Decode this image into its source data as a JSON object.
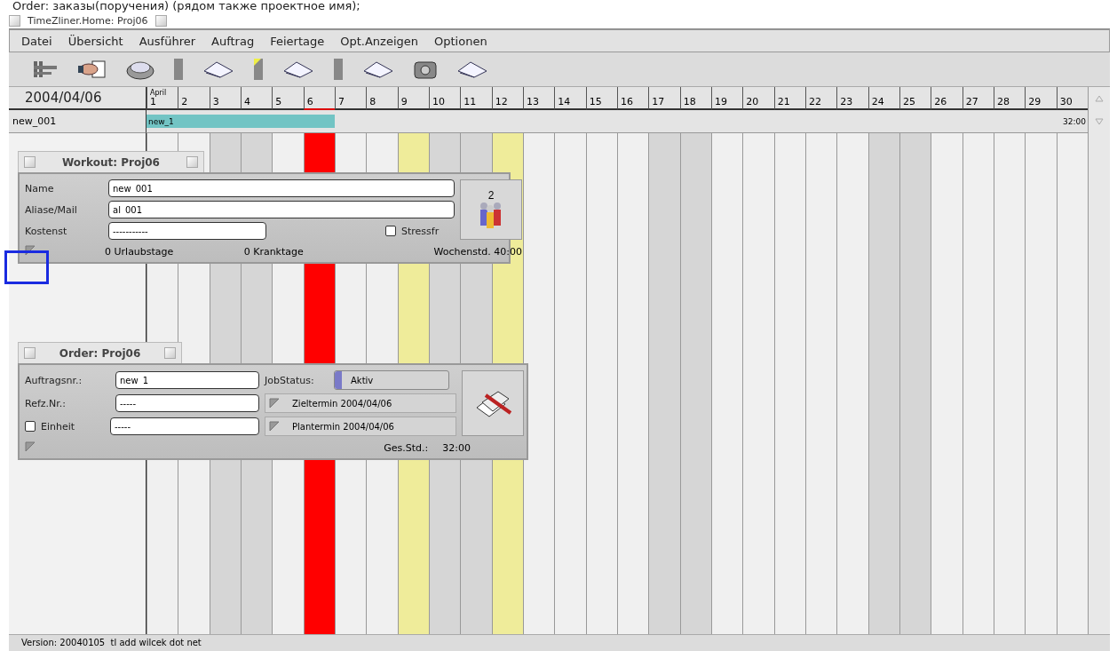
{
  "caption": "Order: заказы(поручения) (рядом также проектное имя);",
  "window": {
    "title": "TimeZliner.Home: Proj06"
  },
  "menu": [
    "Datei",
    "Übersicht",
    "Ausführer",
    "Auftrag",
    "Feiertage",
    "Opt.Anzeigen",
    "Optionen"
  ],
  "timeline": {
    "date": "2004/04/06",
    "month": "April",
    "days": [
      {
        "label": "1",
        "kind": "weekday"
      },
      {
        "label": "2",
        "kind": "weekday"
      },
      {
        "label": "3",
        "kind": "weekend"
      },
      {
        "label": "4",
        "kind": "weekend"
      },
      {
        "label": "5",
        "kind": "weekday"
      },
      {
        "label": "6",
        "kind": "today"
      },
      {
        "label": "7",
        "kind": "weekday"
      },
      {
        "label": "8",
        "kind": "weekday"
      },
      {
        "label": "9",
        "kind": "holiday"
      },
      {
        "label": "10",
        "kind": "weekend"
      },
      {
        "label": "11",
        "kind": "weekend"
      },
      {
        "label": "12",
        "kind": "holiday"
      },
      {
        "label": "13",
        "kind": "weekday"
      },
      {
        "label": "14",
        "kind": "weekday"
      },
      {
        "label": "15",
        "kind": "weekday"
      },
      {
        "label": "16",
        "kind": "weekday"
      },
      {
        "label": "17",
        "kind": "weekend"
      },
      {
        "label": "18",
        "kind": "weekend"
      },
      {
        "label": "19",
        "kind": "weekday"
      },
      {
        "label": "20",
        "kind": "weekday"
      },
      {
        "label": "21",
        "kind": "weekday"
      },
      {
        "label": "22",
        "kind": "weekday"
      },
      {
        "label": "23",
        "kind": "weekday"
      },
      {
        "label": "24",
        "kind": "weekend"
      },
      {
        "label": "25",
        "kind": "weekend"
      },
      {
        "label": "26",
        "kind": "weekday"
      },
      {
        "label": "27",
        "kind": "weekday"
      },
      {
        "label": "28",
        "kind": "weekday"
      },
      {
        "label": "29",
        "kind": "weekday"
      },
      {
        "label": "30",
        "kind": "weekday"
      }
    ]
  },
  "row": {
    "name": "new_001",
    "bar_label": "new_1",
    "booked": [
      true,
      true,
      true,
      true,
      true,
      true,
      false,
      false,
      false,
      false,
      false,
      false,
      false,
      false,
      false,
      false,
      false,
      false,
      false,
      false,
      false,
      false,
      false,
      false,
      false,
      false,
      false,
      false,
      false,
      false
    ],
    "total": "32:00"
  },
  "workout": {
    "title": "Workout: Proj06",
    "fields": [
      {
        "label": "Name",
        "value": "new_001"
      },
      {
        "label": "Aliase/Mail",
        "value": "al_001"
      },
      {
        "label": "Kostenst",
        "value": "-----------"
      }
    ],
    "stress": {
      "label": "Stressfr",
      "checked": false
    },
    "count": "2",
    "footer": [
      "0 Urlaubstage",
      "0 Kranktage",
      "Wochenstd. 40:00"
    ]
  },
  "order": {
    "title": "Order: Proj06",
    "fields": [
      {
        "label": "Auftragsnr.:",
        "value": "new_1",
        "kind": "text"
      },
      {
        "label": "Refz.Nr.:",
        "value": "-----",
        "kind": "text"
      },
      {
        "label": "Einheit",
        "value": "-----",
        "kind": "checkbox",
        "checked": false
      }
    ],
    "status_label": "JobStatus:",
    "status": "Aktiv",
    "dates": [
      "Zieltermin 2004/04/06",
      "Plantermin 2004/04/06"
    ],
    "total_label": "Ges.Std.:",
    "total": "32:00"
  },
  "status_bar": "Version: 20040105  tl add wilcek dot net"
}
